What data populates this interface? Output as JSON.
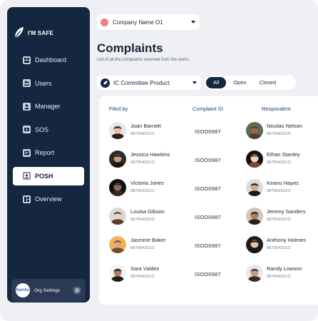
{
  "brand": {
    "name": "I'M SAFE"
  },
  "nav": {
    "items": [
      {
        "label": "Dashboard",
        "icon": "dashboard-icon"
      },
      {
        "label": "Users",
        "icon": "users-icon"
      },
      {
        "label": "Manager",
        "icon": "manager-icon"
      },
      {
        "label": "SOS",
        "icon": "sos-icon"
      },
      {
        "label": "Report",
        "icon": "report-icon"
      },
      {
        "label": "POSH",
        "icon": "posh-icon",
        "active": true
      },
      {
        "label": "Overview",
        "icon": "overview-icon"
      }
    ]
  },
  "org": {
    "label": "Org Settings",
    "avatar_text": "NutriGe"
  },
  "company": {
    "name": "Company Name O1",
    "color": "#f08080"
  },
  "page": {
    "title": "Complaints",
    "subtitle": "List of all the complaints received from the users."
  },
  "filter": {
    "label": "IC Committee Product"
  },
  "status_tabs": {
    "all": "All",
    "open": "Open",
    "closed": "Closed",
    "selected": "All"
  },
  "table": {
    "headers": {
      "filed_by": "Filed by",
      "complaint_id": "Complaint ID",
      "respondent": "Respondent"
    },
    "rows": [
      {
        "filer": "Joan Barnett",
        "filer_phone": "987654321O",
        "id": "ISOO0987",
        "respondent": "Nicolas Nelson",
        "respondent_phone": "987654321O"
      },
      {
        "filer": "Jessica Hawkins",
        "filer_phone": "987654321O",
        "id": "ISOO0987",
        "respondent": "Ethan Stanley",
        "respondent_phone": "987654321O"
      },
      {
        "filer": "Victoria Jones",
        "filer_phone": "987654321O",
        "id": "ISOO0987",
        "respondent": "Keanu Hayes",
        "respondent_phone": "987654321O"
      },
      {
        "filer": "Louisa Gibson",
        "filer_phone": "987654321O",
        "id": "ISOO0987",
        "respondent": "Jeremy Sanders",
        "respondent_phone": "987654321O"
      },
      {
        "filer": "Jasmine Baker",
        "filer_phone": "987654321O",
        "id": "ISOO0987",
        "respondent": "Anthony Holmes",
        "respondent_phone": "987654321O"
      },
      {
        "filer": "Sara Valdez",
        "filer_phone": "987654321O",
        "id": "ISOO0987",
        "respondent": "Randy Lowson",
        "respondent_phone": "987654321O"
      }
    ]
  },
  "colors": {
    "sidebar": "#152640",
    "accent": "#1c3f80",
    "background": "#eef0f3"
  }
}
